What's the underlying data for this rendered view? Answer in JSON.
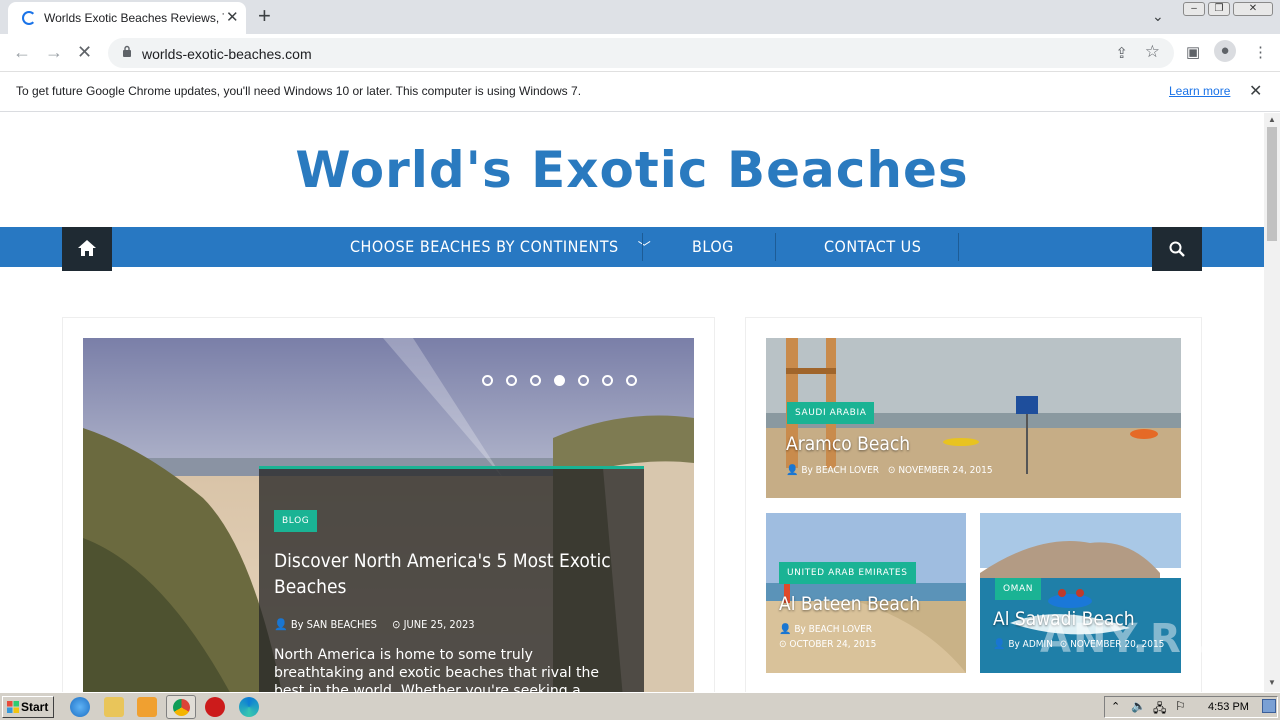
{
  "browser": {
    "tab_title": "Worlds Exotic Beaches Reviews, Travel",
    "url": "worlds-exotic-beaches.com",
    "infobar_message": "To get future Google Chrome updates, you'll need Windows 10 or later. This computer is using Windows 7.",
    "infobar_link": "Learn more"
  },
  "site": {
    "logo": "World's Exotic Beaches",
    "menu": {
      "continents": "CHOOSE BEACHES BY CONTINENTS",
      "blog": "BLOG",
      "contact": "CONTACT US"
    }
  },
  "featured": {
    "category": "BLOG",
    "title": "Discover North America's 5 Most Exotic Beaches",
    "author": "By SAN BEACHES",
    "date": "JUNE 25, 2023",
    "excerpt": "North America is home to some truly breathtaking and exotic beaches that rival the best in the world. Whether you're seeking a",
    "slides_total": 7,
    "active_slide": 4
  },
  "cards": [
    {
      "category": "SAUDI ARABIA",
      "title": "Aramco Beach",
      "author": "By BEACH LOVER",
      "date": "NOVEMBER 24, 2015"
    },
    {
      "category": "UNITED ARAB EMIRATES",
      "title": "Al Bateen Beach",
      "author": "By BEACH LOVER",
      "date": "OCTOBER 24, 2015"
    },
    {
      "category": "OMAN",
      "title": "Al Sawadi Beach",
      "author": "By ADMIN",
      "date": "NOVEMBER 20, 2015"
    }
  ],
  "taskbar": {
    "start": "Start",
    "clock": "4:53 PM"
  },
  "watermark": "ANY.RUN",
  "colors": {
    "brand_blue": "#2878c2",
    "accent_green": "#1ab394",
    "dark": "#1f2a33"
  }
}
